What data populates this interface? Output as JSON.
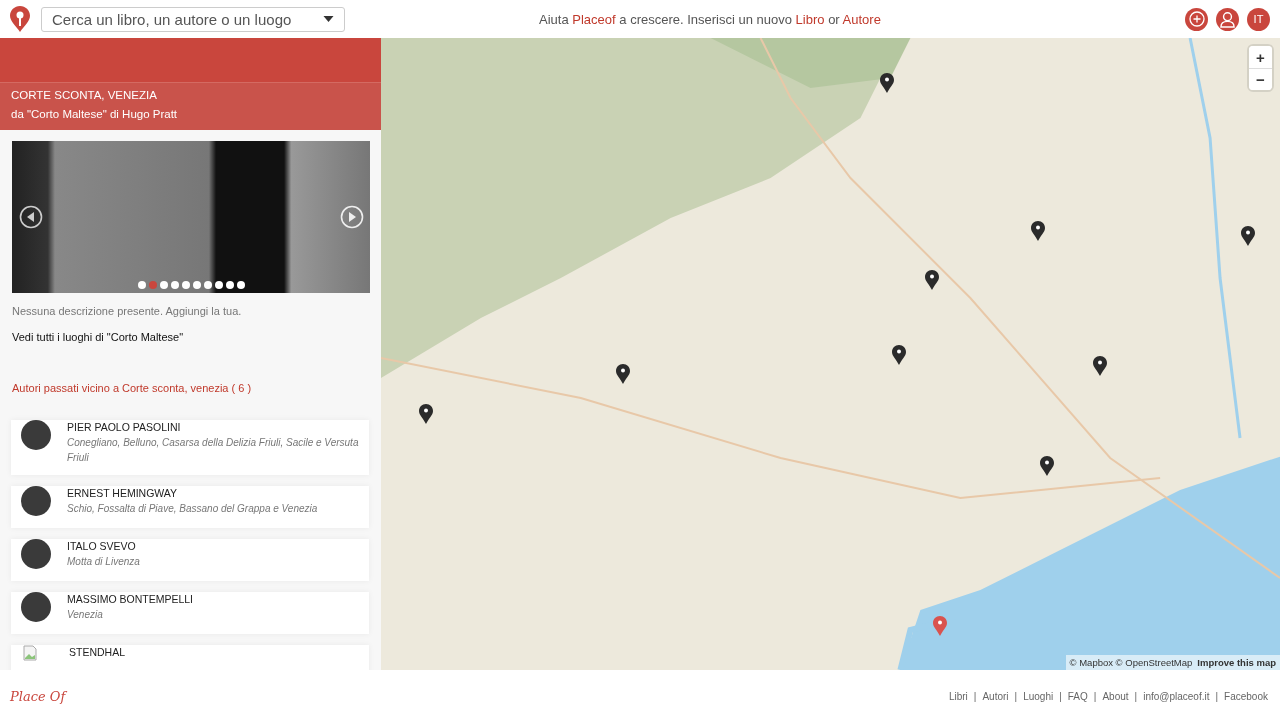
{
  "header": {
    "search": {
      "placeholder": "Cerca un libro, un autore o un luogo"
    },
    "promo": [
      {
        "kind": "text",
        "text": "Aiuta "
      },
      {
        "kind": "link",
        "text": "Placeof"
      },
      {
        "kind": "text",
        "text": " a crescere. Inserisci un nuovo "
      },
      {
        "kind": "link",
        "text": "Libro"
      },
      {
        "kind": "text",
        "text": " or "
      },
      {
        "kind": "link",
        "text": "Autore"
      }
    ],
    "language": "IT"
  },
  "place": {
    "title": "CORTE SCONTA, VENEZIA",
    "subtitle": "da \"Corto Maltese\" di Hugo Pratt",
    "slides": [
      {
        "selected": false
      },
      {
        "selected": true
      },
      {
        "selected": false
      },
      {
        "selected": false
      },
      {
        "selected": false
      },
      {
        "selected": false
      },
      {
        "selected": false
      },
      {
        "selected": false
      },
      {
        "selected": false
      },
      {
        "selected": false
      }
    ],
    "description": "Nessuna descrizione presente. Aggiungi la tua.",
    "all_places_link": "Vedi tutti i luoghi di \"Corto Maltese\"",
    "authors_heading": "Autori passati vicino a Corte sconta, venezia ( 6 )"
  },
  "authors": [
    {
      "kind": "photo",
      "name": "PIER PAOLO PASOLINI",
      "places": "Conegliano, Belluno, Casarsa della Delizia Friuli, Sacile e Versuta Friuli"
    },
    {
      "kind": "photo",
      "name": "ERNEST HEMINGWAY",
      "places": "Schio, Fossalta di Piave, Bassano del Grappa e Venezia"
    },
    {
      "kind": "photo",
      "name": "ITALO SVEVO",
      "places": "Motta di Livenza"
    },
    {
      "kind": "photo",
      "name": "MASSIMO BONTEMPELLI",
      "places": "Venezia"
    },
    {
      "kind": "broken",
      "name": "STENDHAL"
    }
  ],
  "map": {
    "pins": [
      {
        "selected": false
      },
      {
        "selected": false
      },
      {
        "selected": false
      },
      {
        "selected": false
      },
      {
        "selected": false
      },
      {
        "selected": false
      },
      {
        "selected": false
      },
      {
        "selected": false
      },
      {
        "selected": false
      },
      {
        "selected": true
      }
    ],
    "zoom_in": "+",
    "zoom_out": "−",
    "attribution": "© Mapbox © OpenStreetMap",
    "improve_link": "Improve this map"
  },
  "footer": {
    "logo": "Place Of",
    "links": [
      "Libri",
      "Autori",
      "Luoghi",
      "FAQ",
      "About",
      "info@placeof.it",
      "Facebook"
    ],
    "separator": "|"
  }
}
